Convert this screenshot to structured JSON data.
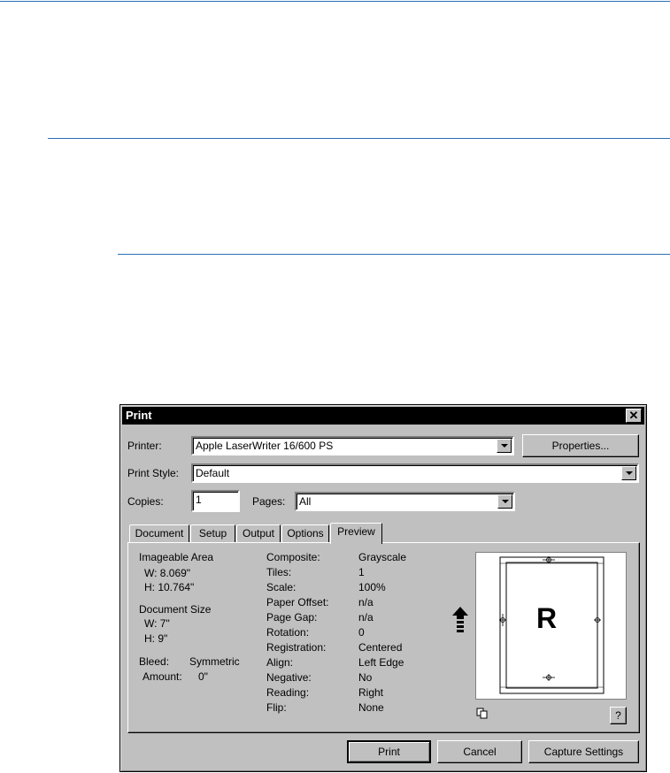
{
  "dialog": {
    "title": "Print",
    "printer_label": "Printer:",
    "printer_value": "Apple LaserWriter 16/600 PS",
    "properties_button": "Properties...",
    "print_style_label": "Print Style:",
    "print_style_value": "Default",
    "copies_label": "Copies:",
    "copies_value": "1",
    "pages_label": "Pages:",
    "pages_value": "All",
    "tabs": [
      "Document",
      "Setup",
      "Output",
      "Options",
      "Preview"
    ],
    "active_tab": "Preview",
    "preview": {
      "imageable_area_label": "Imageable Area",
      "imageable_w": "W:  8.069\"",
      "imageable_h": "H:  10.764\"",
      "document_size_label": "Document Size",
      "doc_w": "W:  7\"",
      "doc_h": "H:  9\"",
      "bleed_label": "Bleed:",
      "bleed_value": "Symmetric",
      "amount_label": "Amount:",
      "amount_value": "0\"",
      "settings": [
        {
          "label": "Composite:",
          "value": "Grayscale"
        },
        {
          "label": "Tiles:",
          "value": "1"
        },
        {
          "label": "Scale:",
          "value": "100%"
        },
        {
          "label": "Paper Offset:",
          "value": "n/a"
        },
        {
          "label": "Page Gap:",
          "value": "n/a"
        },
        {
          "label": "Rotation:",
          "value": "0"
        },
        {
          "label": "Registration:",
          "value": "Centered"
        },
        {
          "label": "Align:",
          "value": "Left Edge"
        },
        {
          "label": "Negative:",
          "value": "No"
        },
        {
          "label": "Reading:",
          "value": "Right"
        },
        {
          "label": "Flip:",
          "value": "None"
        }
      ],
      "page_letter": "R",
      "help_button": "?"
    },
    "buttons": {
      "print": "Print",
      "cancel": "Cancel",
      "capture": "Capture Settings"
    }
  },
  "colors": {
    "rule": "#2a6fb5",
    "dialog_bg": "#c0c0c0",
    "title_bar": "#000000"
  }
}
